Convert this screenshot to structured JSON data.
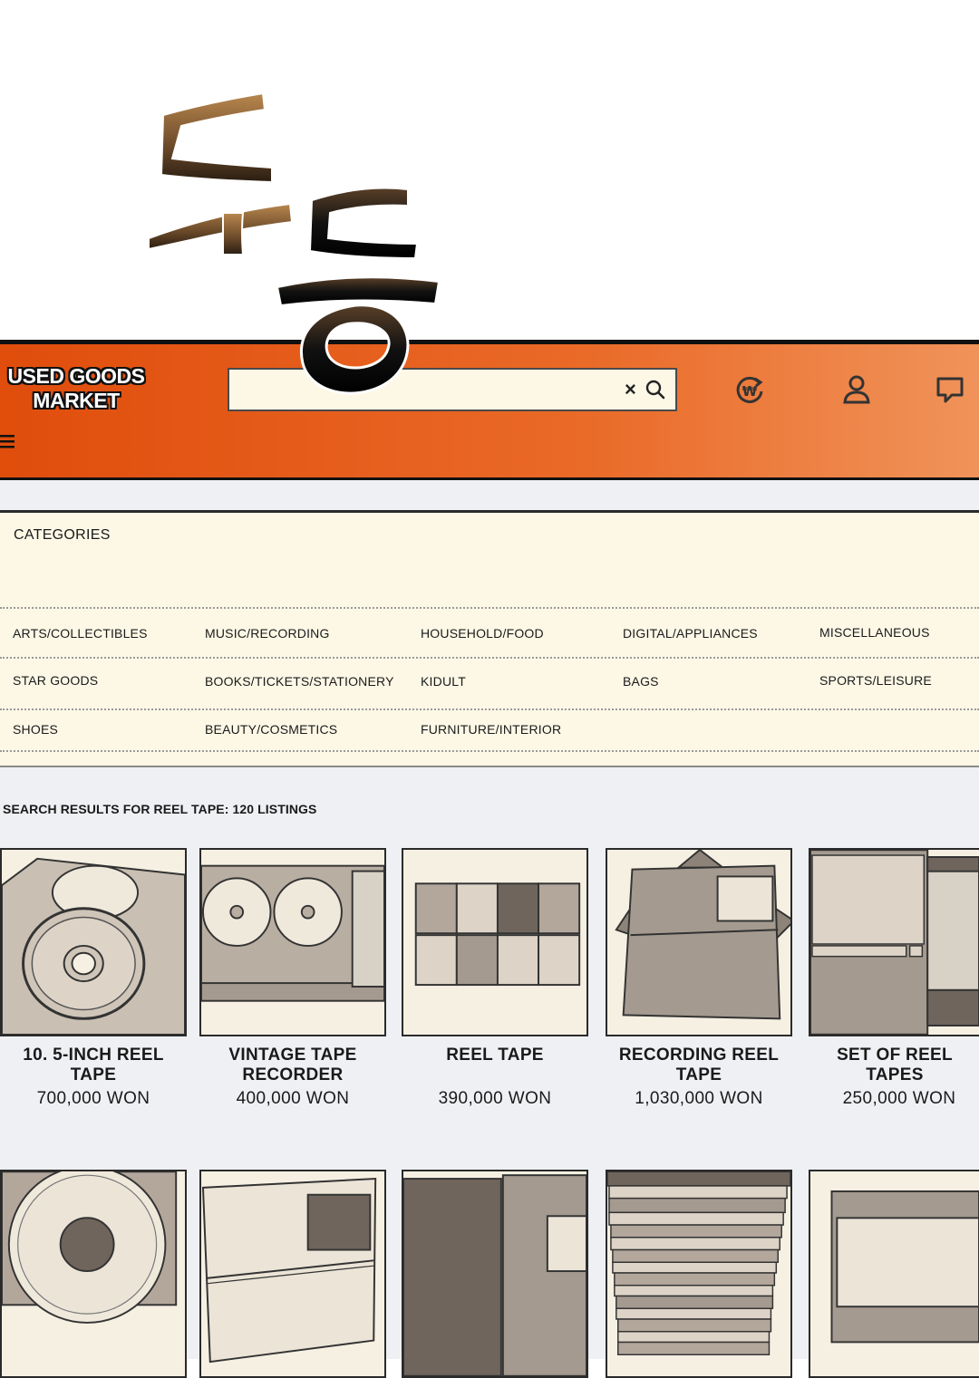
{
  "sfx_text": "두둥",
  "header": {
    "logo": "USED GOODS MARKET",
    "search": {
      "value": "",
      "placeholder": ""
    },
    "icons": [
      "won-refresh-icon",
      "user-icon",
      "chat-icon",
      "menu-icon"
    ]
  },
  "categories": {
    "title": "CATEGORIES",
    "rows": [
      [
        "ARTS/COLLECTIBLES",
        "MUSIC/RECORDING",
        "HOUSEHOLD/FOOD",
        "DIGITAL/APPLIANCES",
        "MISCELLANEOUS"
      ],
      [
        "STAR GOODS",
        "BOOKS/TICKETS/STATIONERY",
        "KIDULT",
        "BAGS",
        "SPORTS/LEISURE"
      ],
      [
        "SHOES",
        "BEAUTY/COSMETICS",
        "FURNITURE/INTERIOR"
      ]
    ]
  },
  "results": {
    "title": "SEARCH RESULTS FOR REEL TAPE: 120 LISTINGS",
    "items": [
      {
        "name": "10. 5-INCH REEL TAPE",
        "price": "700,000 WON"
      },
      {
        "name": "VINTAGE TAPE RECORDER",
        "price": "400,000 WON"
      },
      {
        "name": "REEL TAPE",
        "price": "390,000 WON"
      },
      {
        "name": "RECORDING REEL TAPE",
        "price": "1,030,000 WON"
      },
      {
        "name": "SET OF REEL TAPES",
        "price": "250,000 WON"
      }
    ]
  },
  "colors": {
    "header_orange": "#e04d0c",
    "panel_cream": "#fdf8e6",
    "page_gray": "#eef0f3"
  }
}
